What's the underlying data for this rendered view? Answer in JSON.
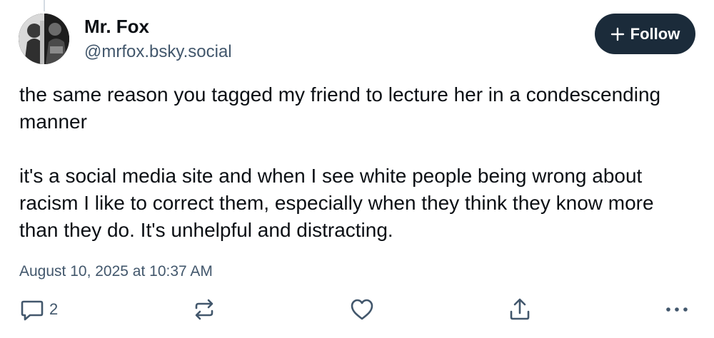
{
  "author": {
    "display_name": "Mr. Fox",
    "handle": "@mrfox.bsky.social",
    "avatar_icon": "user-avatar-photo"
  },
  "follow": {
    "label": "Follow",
    "icon": "plus-icon"
  },
  "post": {
    "paragraphs": [
      "the same reason you tagged my friend to lecture her in a condescending manner",
      "it's a social media site and when I see white people being wrong about racism I like to correct them, especially when they think they know more than they do. It's unhelpful and distracting."
    ],
    "timestamp": "August 10, 2025 at 10:37 AM"
  },
  "actions": {
    "reply_count": "2",
    "reply_icon": "reply-bubble-icon",
    "repost_icon": "repost-icon",
    "like_icon": "heart-icon",
    "share_icon": "share-icon",
    "more_icon": "more-options-icon"
  },
  "colors": {
    "text_primary": "#0b0f14",
    "text_secondary": "#42576c",
    "follow_bg": "#1b2b3a",
    "thread_line": "#d4dbe2"
  }
}
